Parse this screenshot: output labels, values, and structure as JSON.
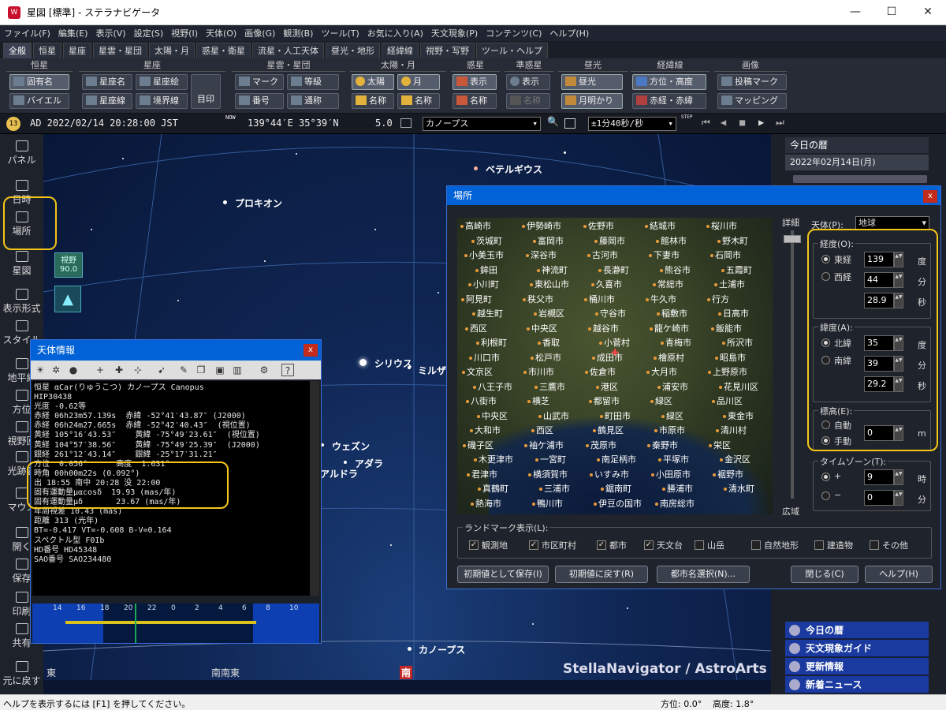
{
  "window": {
    "title": "星図 [標準] - ステラナビゲータ",
    "app_icon": "W"
  },
  "menu": [
    "ファイル(F)",
    "編集(E)",
    "表示(V)",
    "設定(S)",
    "視野(I)",
    "天体(O)",
    "画像(G)",
    "観測(B)",
    "ツール(T)",
    "お気に入り(A)",
    "天文現象(P)",
    "コンテンツ(C)",
    "ヘルプ(H)"
  ],
  "tabs": [
    "全般",
    "恒星",
    "星座",
    "星雲・星団",
    "太陽・月",
    "惑星・衛星",
    "流星・人工天体",
    "昼光・地形",
    "経緯線",
    "視野・写野",
    "ツール・ヘルプ"
  ],
  "ribbon": {
    "groups": [
      "恒星",
      "星座",
      "星雲・星団",
      "太陽・月",
      "惑星",
      "準惑星",
      "昼光",
      "経緯線",
      "画像"
    ],
    "btn": {
      "fixed_name": "固有名",
      "bayer": "バイエル",
      "const_name": "星座名",
      "const_pic": "星座絵",
      "const_line": "星座線",
      "boundary": "境界線",
      "mark": "目印",
      "neb_mark": "マーク",
      "number": "番号",
      "grade": "等級",
      "common": "通称",
      "sun": "太陽",
      "moon": "月",
      "sun_name": "名称",
      "moon_name": "名称",
      "planet_show": "表示",
      "planet_name": "名称",
      "dwarf_show": "表示",
      "dwarf_name": "名称",
      "daylight": "昼光",
      "moonlight": "月明かり",
      "azalt": "方位・高度",
      "radec": "赤経・赤緯",
      "marker": "投稿マーク",
      "mapping": "マッピング"
    }
  },
  "statebar": {
    "datetime": "AD 2022/02/14 20:28:00 JST",
    "now": "NOW",
    "location": "139°44′E 35°39′N",
    "magnitude": "5.0",
    "target": "カノープス",
    "speed": "±1分40秒/秒",
    "step": "STEP"
  },
  "leftbar": [
    "パネル",
    "日時",
    "場所",
    "星図",
    "表示形式",
    "スタイル",
    "地平線",
    "方位",
    "視野回",
    "光跡表",
    "マウス",
    "開く",
    "保存",
    "印刷",
    "共有",
    "元に戻す"
  ],
  "fov": {
    "label": "視野",
    "value": "90.0"
  },
  "sky": {
    "stars": [
      {
        "name": "ベテルギウス"
      },
      {
        "name": "プロキオン"
      },
      {
        "name": "シリウス"
      },
      {
        "name": "ミルザム"
      },
      {
        "name": "ウェズン"
      },
      {
        "name": "アダラ"
      },
      {
        "name": "アルドラ"
      },
      {
        "name": "カノープス"
      }
    ],
    "compass": [
      "東",
      "南南東",
      "南"
    ],
    "watermark": "StellaNavigator / AstroArts"
  },
  "rightpanel": {
    "header": "今日の暦",
    "date": "2022年02月14日(月)",
    "items": [
      "今日の暦",
      "天文現象ガイド",
      "更新情報",
      "新着ニュース"
    ]
  },
  "status": {
    "help": "ヘルプを表示するには [F1] を押してください。",
    "azimuth": "方位:  0.0°",
    "altitude": "高度:  1.8°"
  },
  "infowin": {
    "title": "天体情報",
    "lines": [
      "恒星 αCar(りゅうこつ) カノープス Canopus",
      "HIP30438",
      "光度 -0.62等",
      "赤経 06h23m57.139s  赤緯 -52°41′43.87″ (J2000)",
      "赤経 06h24m27.665s  赤緯 -52°42′40.43″  (視位置)",
      "黄経 105°16′43.53″    黄緯 -75°49′23.61″  (視位置)",
      "黄経 104°57′38.56″    黄緯 -75°49′25.39″  (J2000)",
      "銀経 261°12′43.14″    銀緯 -25°17′31.21″",
      "方位  0.056°      高度  1.631°",
      "時角 00h00m22s (0.092°)",
      "出 18:55 南中 20:28 没 22:00",
      "固有運動量μαcosδ  19.93 (mas/年)",
      "固有運動量μδ       23.67 (mas/年)",
      "年周視差 10.43 (mas)",
      "距離 313 (光年)",
      "BT=-0.417 VT=-0.608 B-V=0.164",
      "スペクトル型 F0Ib",
      "HD番号 HD45348",
      "SAO番号 SAO234480"
    ],
    "timeline": [
      "14",
      "16",
      "18",
      "20",
      "22",
      "0",
      "2",
      "4",
      "6",
      "8",
      "10"
    ]
  },
  "placewin": {
    "title": "場所",
    "detail": "詳細",
    "wide": "広域",
    "body_label": "天体(P):",
    "body": "地球",
    "lon_label": "経度(O):",
    "east": "東経",
    "west": "西経",
    "lon_deg": "139",
    "lon_min": "44",
    "lon_sec": "28.9",
    "lat_label": "緯度(A):",
    "north": "北緯",
    "south": "南緯",
    "lat_deg": "35",
    "lat_min": "39",
    "lat_sec": "29.2",
    "deg": "度",
    "min": "分",
    "sec": "秒",
    "elev_label": "標高(E):",
    "auto": "自動",
    "manual": "手動",
    "elev": "0",
    "m": "m",
    "tz_label": "タイムゾーン(T):",
    "plus": "+",
    "minus": "−",
    "tz_h": "9",
    "tz_m": "0",
    "hour": "時",
    "tmin": "分",
    "landmark_label": "ランドマーク表示(L):",
    "landmarks": [
      {
        "label": "観測地",
        "on": true
      },
      {
        "label": "市区町村",
        "on": true
      },
      {
        "label": "都市",
        "on": true
      },
      {
        "label": "天文台",
        "on": true
      },
      {
        "label": "山岳",
        "on": false
      },
      {
        "label": "自然地形",
        "on": false
      },
      {
        "label": "建造物",
        "on": false
      },
      {
        "label": "その他",
        "on": false
      }
    ],
    "buttons": [
      "初期値として保存(I)",
      "初期値に戻す(R)",
      "都市名選択(N)...",
      "閉じる(C)",
      "ヘルプ(H)"
    ],
    "cities": [
      "高崎市",
      "伊勢崎市",
      "佐野市",
      "結城市",
      "桜川市",
      "茨城町",
      "富岡市",
      "藤岡市",
      "館林市",
      "野木町",
      "小美玉市",
      "深谷市",
      "古河市",
      "下妻市",
      "石岡市",
      "鉾田",
      "神流町",
      "長瀞町",
      "熊谷市",
      "五霞町",
      "小川町",
      "東松山市",
      "久喜市",
      "常総市",
      "土浦市",
      "阿見町",
      "秩父市",
      "桶川市",
      "牛久市",
      "行方",
      "越生町",
      "岩槻区",
      "守谷市",
      "稲敷市",
      "日高市",
      "西区",
      "中央区",
      "越谷市",
      "龍ケ崎市",
      "飯能市",
      "利根町",
      "香取",
      "小菅村",
      "青梅市",
      "所沢市",
      "川口市",
      "松戸市",
      "成田市",
      "檜原村",
      "昭島市",
      "文京区",
      "市川市",
      "佐倉市",
      "大月市",
      "上野原市",
      "八王子市",
      "三鷹市",
      "港区",
      "浦安市",
      "花見川区",
      "八街市",
      "横芝",
      "都留市",
      "緑区",
      "品川区",
      "中央区",
      "山武市",
      "町田市",
      "緑区",
      "東金市",
      "大和市",
      "西区",
      "鶴見区",
      "市原市",
      "清川村",
      "磯子区",
      "袖ケ浦市",
      "茂原市",
      "秦野市",
      "栄区",
      "木更津市",
      "一宮町",
      "南足柄市",
      "平塚市",
      "金沢区",
      "君津市",
      "横須賀市",
      "いすみ市",
      "小田原市",
      "裾野市",
      "真鶴町",
      "三浦市",
      "鋸南町",
      "勝浦市",
      "清水町",
      "熱海市",
      "鴨川市",
      "伊豆の国市",
      "南房総市"
    ]
  }
}
